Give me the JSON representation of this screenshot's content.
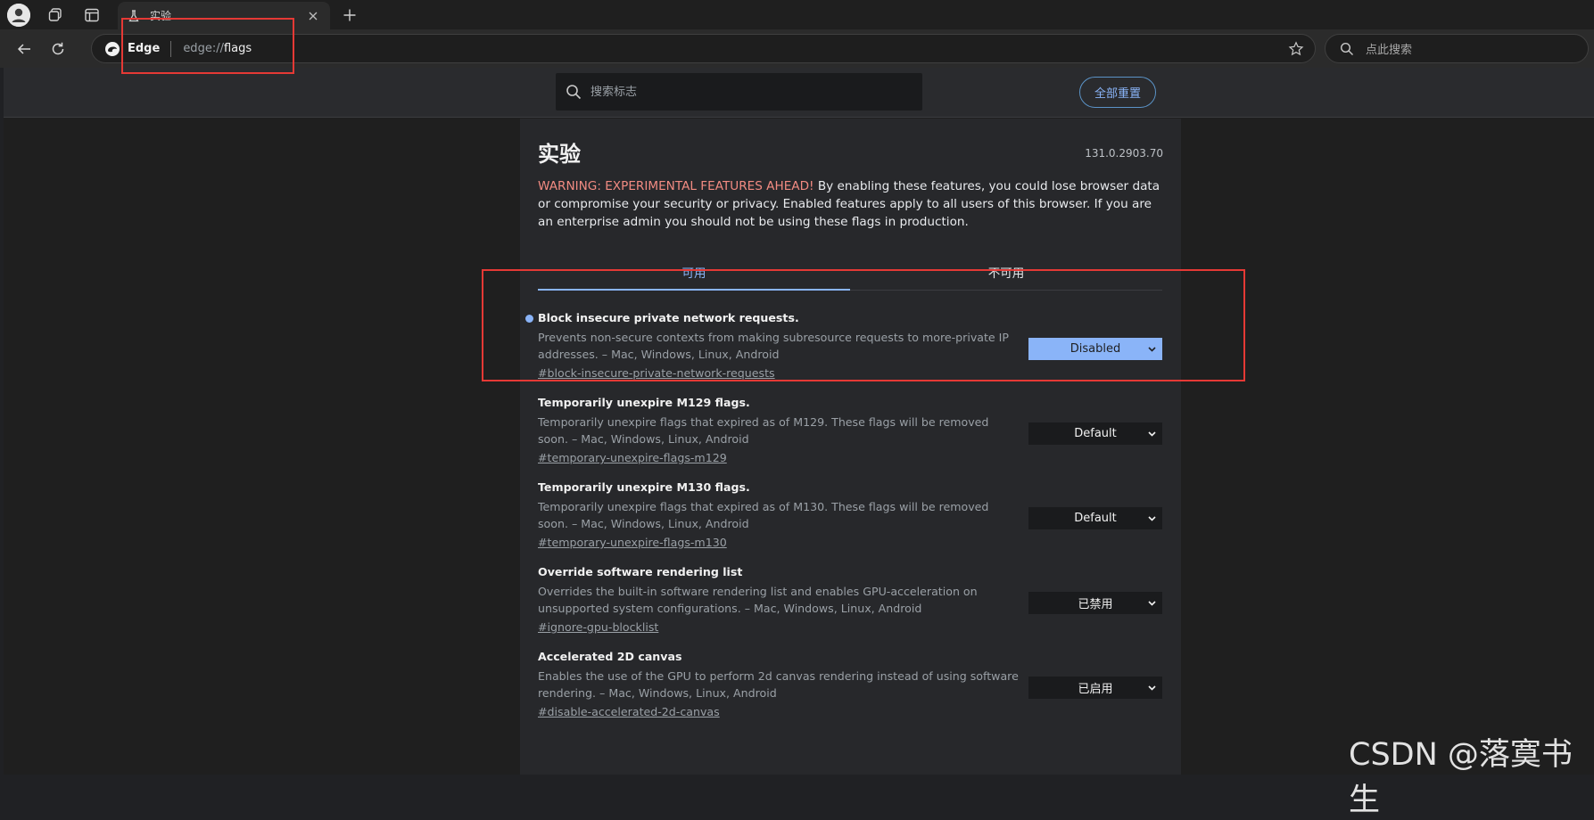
{
  "browser": {
    "tab": {
      "title": "实验"
    },
    "omnibox": {
      "site_label": "Edge",
      "url_scheme": "edge://",
      "url_path": "flags"
    },
    "sidebar_search": {
      "placeholder": "点此搜索"
    }
  },
  "flags_page": {
    "search_placeholder": "搜索标志",
    "reset_all_label": "全部重置",
    "title": "实验",
    "version": "131.0.2903.70",
    "warning_head": "WARNING: EXPERIMENTAL FEATURES AHEAD!",
    "warning_body": " By enabling these features, you could lose browser data or compromise your security or privacy. Enabled features apply to all users of this browser. If you are an enterprise admin you should not be using these flags in production.",
    "tabs": [
      {
        "label": "可用"
      },
      {
        "label": "不可用"
      }
    ],
    "flags": [
      {
        "name": "Block insecure private network requests.",
        "description": "Prevents non-secure contexts from making subresource requests to more-private IP addresses. – Mac, Windows, Linux, Android",
        "link": "#block-insecure-private-network-requests",
        "value": "Disabled"
      },
      {
        "name": "Temporarily unexpire M129 flags.",
        "description": "Temporarily unexpire flags that expired as of M129. These flags will be removed soon. – Mac, Windows, Linux, Android",
        "link": "#temporary-unexpire-flags-m129",
        "value": "Default"
      },
      {
        "name": "Temporarily unexpire M130 flags.",
        "description": "Temporarily unexpire flags that expired as of M130. These flags will be removed soon. – Mac, Windows, Linux, Android",
        "link": "#temporary-unexpire-flags-m130",
        "value": "Default"
      },
      {
        "name": "Override software rendering list",
        "description": "Overrides the built-in software rendering list and enables GPU-acceleration on unsupported system configurations. – Mac, Windows, Linux, Android",
        "link": "#ignore-gpu-blocklist",
        "value": "已禁用"
      },
      {
        "name": "Accelerated 2D canvas",
        "description": "Enables the use of the GPU to perform 2d canvas rendering instead of using software rendering. – Mac, Windows, Linux, Android",
        "link": "#disable-accelerated-2d-canvas",
        "value": "已启用"
      }
    ]
  },
  "watermark": "CSDN @落寞书生",
  "colors": {
    "accent": "#8ab4f8",
    "warning": "#f28b82",
    "annotation": "#e53935"
  }
}
